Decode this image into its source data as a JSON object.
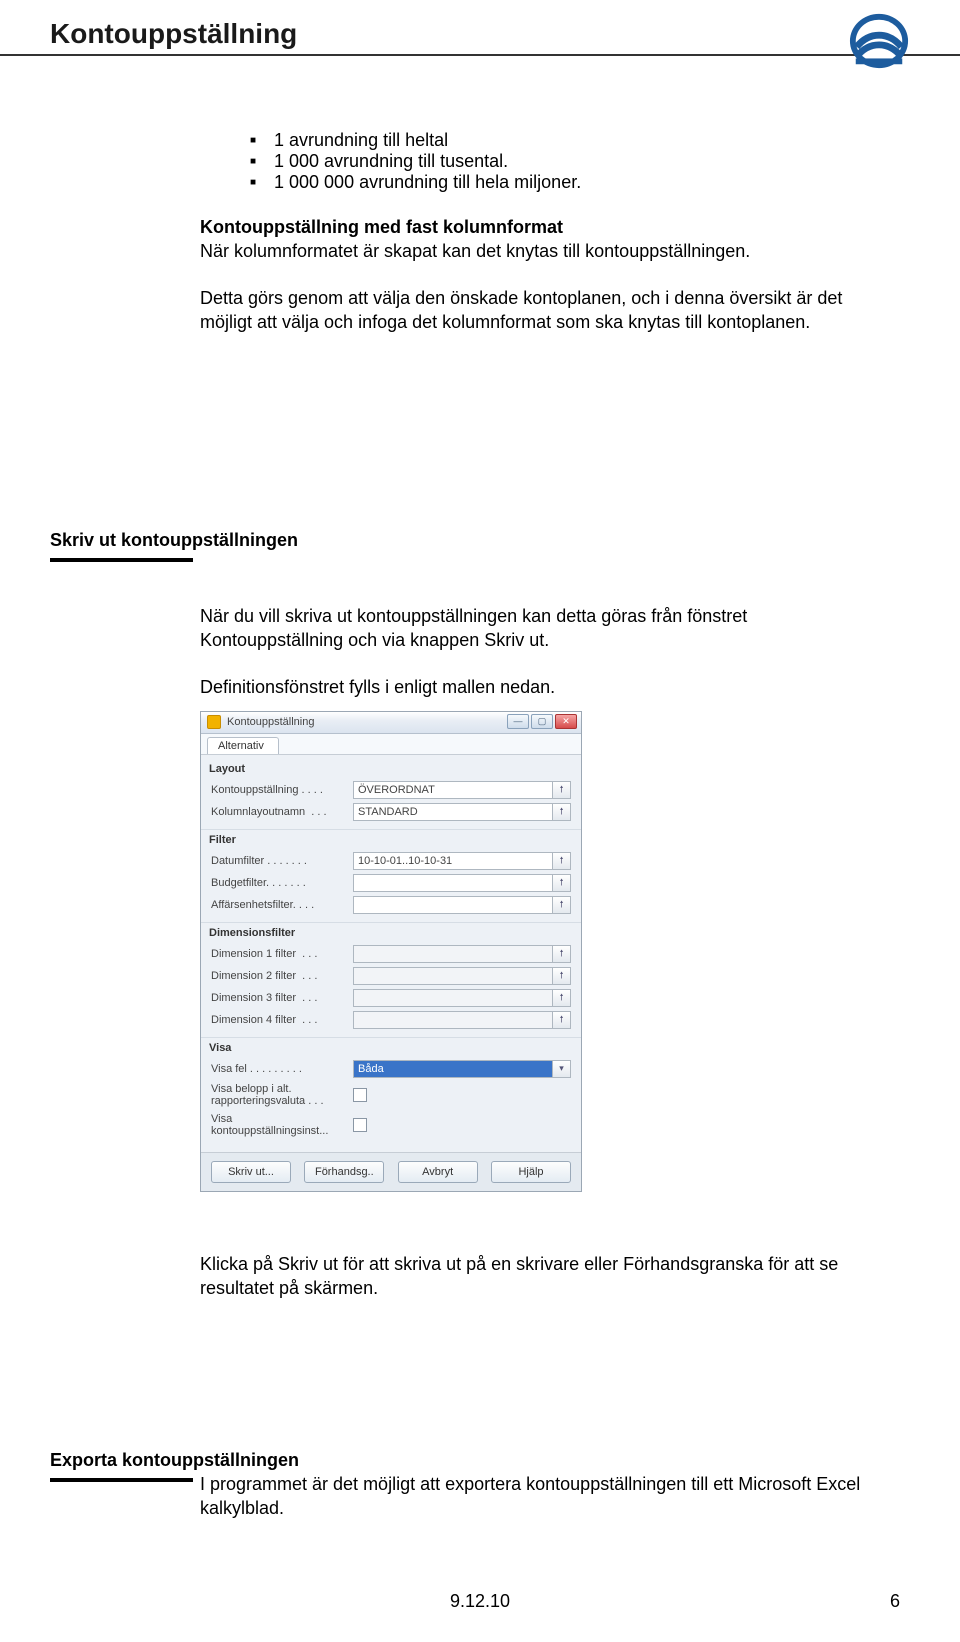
{
  "page_title": "Kontouppställning",
  "bullets": [
    "1 avrundning till heltal",
    "1 000 avrundning till tusental.",
    "1 000 000 avrundning till hela miljoner."
  ],
  "fast_kolumn": {
    "heading": "Kontouppställning med fast kolumnformat",
    "p1": "När kolumnformatet är skapat kan det knytas till kontouppställningen.",
    "p2": "Detta görs genom att välja den önskade kontoplanen, och i denna översikt är det möjligt att välja och infoga det kolumnformat som ska knytas till kontoplanen."
  },
  "skriv_ut": {
    "heading": "Skriv ut kontouppställningen",
    "p1": "När du vill skriva ut kontouppställningen kan detta göras från fönstret Kontouppställning och via knappen Skriv ut.",
    "p2": "Definitionsfönstret fylls i enligt mallen nedan.",
    "p3": "Klicka på Skriv ut för att skriva ut på en skrivare eller Förhandsgranska för att se resultatet på skärmen."
  },
  "export": {
    "heading": "Exporta kontouppställningen",
    "p1": "I programmet är det möjligt att exportera kontouppställningen till ett Microsoft Excel kalkylblad."
  },
  "dialog": {
    "title": "Kontouppställning",
    "tab": "Alternativ",
    "groups": {
      "layout": {
        "label": "Layout",
        "rows": [
          {
            "label": "Kontouppställning . . . .",
            "value": "ÖVERORDNAT"
          },
          {
            "label": "Kolumnlayoutnamn  . . .",
            "value": "STANDARD"
          }
        ]
      },
      "filter": {
        "label": "Filter",
        "rows": [
          {
            "label": "Datumfilter . . . . . . .",
            "value": "10-10-01..10-10-31"
          },
          {
            "label": "Budgetfilter. . . . . . .",
            "value": ""
          },
          {
            "label": "Affärsenhetsfilter. . . .",
            "value": ""
          }
        ]
      },
      "dim": {
        "label": "Dimensionsfilter",
        "rows": [
          {
            "label": "Dimension 1 filter  . . .",
            "value": ""
          },
          {
            "label": "Dimension 2 filter  . . .",
            "value": ""
          },
          {
            "label": "Dimension 3 filter  . . .",
            "value": ""
          },
          {
            "label": "Dimension 4 filter  . . .",
            "value": ""
          }
        ]
      },
      "visa": {
        "label": "Visa",
        "row1_label": "Visa fel . . . . . . . . .",
        "row1_value": "Båda",
        "row2_label": "Visa belopp i alt.\nrapporteringsvaluta . . .",
        "row3_label": "Visa\nkontouppställningsinst..."
      }
    },
    "buttons": [
      "Skriv ut...",
      "Förhandsg..",
      "Avbryt",
      "Hjälp"
    ]
  },
  "footer_date": "9.12.10",
  "page_no": "6"
}
